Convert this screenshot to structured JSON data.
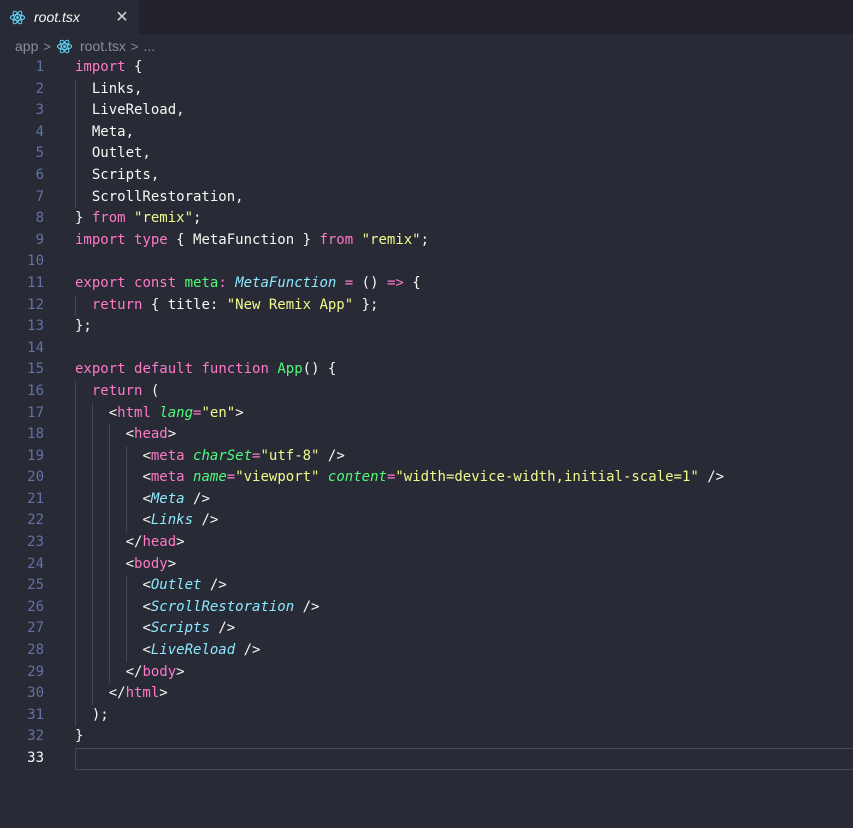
{
  "tab": {
    "title": "root.tsx",
    "icon": "react-icon",
    "close_glyph": "✕"
  },
  "breadcrumb": {
    "folder": "app",
    "file": "root.tsx",
    "more": "...",
    "separator": ">"
  },
  "colors": {
    "background": "#282a36",
    "keyword": "#ff79c6",
    "function": "#50fa7b",
    "string": "#f1fa8c",
    "type": "#8be9fd",
    "line_number": "#6272a4",
    "react_icon": "#61dafb"
  },
  "editor": {
    "active_line": 33,
    "lines": [
      {
        "n": "1",
        "indent": 0,
        "tokens": [
          [
            "k",
            "import"
          ],
          [
            "p",
            " {"
          ]
        ]
      },
      {
        "n": "2",
        "indent": 1,
        "tokens": [
          [
            "p",
            "Links,"
          ]
        ]
      },
      {
        "n": "3",
        "indent": 1,
        "tokens": [
          [
            "p",
            "LiveReload,"
          ]
        ]
      },
      {
        "n": "4",
        "indent": 1,
        "tokens": [
          [
            "p",
            "Meta,"
          ]
        ]
      },
      {
        "n": "5",
        "indent": 1,
        "tokens": [
          [
            "p",
            "Outlet,"
          ]
        ]
      },
      {
        "n": "6",
        "indent": 1,
        "tokens": [
          [
            "p",
            "Scripts,"
          ]
        ]
      },
      {
        "n": "7",
        "indent": 1,
        "tokens": [
          [
            "p",
            "ScrollRestoration,"
          ]
        ]
      },
      {
        "n": "8",
        "indent": 0,
        "tokens": [
          [
            "p",
            "} "
          ],
          [
            "k",
            "from"
          ],
          [
            "p",
            " "
          ],
          [
            "s",
            "\"remix\""
          ],
          [
            "p",
            ";"
          ]
        ]
      },
      {
        "n": "9",
        "indent": 0,
        "tokens": [
          [
            "k",
            "import"
          ],
          [
            "p",
            " "
          ],
          [
            "k",
            "type"
          ],
          [
            "p",
            " { MetaFunction } "
          ],
          [
            "k",
            "from"
          ],
          [
            "p",
            " "
          ],
          [
            "s",
            "\"remix\""
          ],
          [
            "p",
            ";"
          ]
        ]
      },
      {
        "n": "10",
        "indent": 0,
        "tokens": []
      },
      {
        "n": "11",
        "indent": 0,
        "tokens": [
          [
            "k",
            "export"
          ],
          [
            "p",
            " "
          ],
          [
            "k",
            "const"
          ],
          [
            "p",
            " "
          ],
          [
            "f",
            "meta"
          ],
          [
            "k",
            ":"
          ],
          [
            "p",
            " "
          ],
          [
            "t",
            "MetaFunction"
          ],
          [
            "p",
            " "
          ],
          [
            "k",
            "="
          ],
          [
            "p",
            " () "
          ],
          [
            "k",
            "=>"
          ],
          [
            "p",
            " {"
          ]
        ]
      },
      {
        "n": "12",
        "indent": 1,
        "tokens": [
          [
            "k",
            "return"
          ],
          [
            "p",
            " { title: "
          ],
          [
            "s",
            "\"New Remix App\""
          ],
          [
            "p",
            " };"
          ]
        ]
      },
      {
        "n": "13",
        "indent": 0,
        "tokens": [
          [
            "p",
            "};"
          ]
        ]
      },
      {
        "n": "14",
        "indent": 0,
        "tokens": []
      },
      {
        "n": "15",
        "indent": 0,
        "tokens": [
          [
            "k",
            "export"
          ],
          [
            "p",
            " "
          ],
          [
            "k",
            "default"
          ],
          [
            "p",
            " "
          ],
          [
            "k",
            "function"
          ],
          [
            "p",
            " "
          ],
          [
            "f",
            "App"
          ],
          [
            "p",
            "() {"
          ]
        ]
      },
      {
        "n": "16",
        "indent": 1,
        "tokens": [
          [
            "k",
            "return"
          ],
          [
            "p",
            " ("
          ]
        ]
      },
      {
        "n": "17",
        "indent": 2,
        "tokens": [
          [
            "p",
            "<"
          ],
          [
            "tg",
            "html"
          ],
          [
            "p",
            " "
          ],
          [
            "a",
            "lang"
          ],
          [
            "k",
            "="
          ],
          [
            "s",
            "\"en\""
          ],
          [
            "p",
            ">"
          ]
        ]
      },
      {
        "n": "18",
        "indent": 3,
        "tokens": [
          [
            "p",
            "<"
          ],
          [
            "tg",
            "head"
          ],
          [
            "p",
            ">"
          ]
        ]
      },
      {
        "n": "19",
        "indent": 4,
        "tokens": [
          [
            "p",
            "<"
          ],
          [
            "tg",
            "meta"
          ],
          [
            "p",
            " "
          ],
          [
            "a",
            "charSet"
          ],
          [
            "k",
            "="
          ],
          [
            "s",
            "\"utf-8\""
          ],
          [
            "p",
            " />"
          ]
        ]
      },
      {
        "n": "20",
        "indent": 4,
        "tokens": [
          [
            "p",
            "<"
          ],
          [
            "tg",
            "meta"
          ],
          [
            "p",
            " "
          ],
          [
            "a",
            "name"
          ],
          [
            "k",
            "="
          ],
          [
            "s",
            "\"viewport\""
          ],
          [
            "p",
            " "
          ],
          [
            "a",
            "content"
          ],
          [
            "k",
            "="
          ],
          [
            "s",
            "\"width=device-width,initial-scale=1\""
          ],
          [
            "p",
            " />"
          ]
        ]
      },
      {
        "n": "21",
        "indent": 4,
        "tokens": [
          [
            "p",
            "<"
          ],
          [
            "t",
            "Meta"
          ],
          [
            "p",
            " />"
          ]
        ]
      },
      {
        "n": "22",
        "indent": 4,
        "tokens": [
          [
            "p",
            "<"
          ],
          [
            "t",
            "Links"
          ],
          [
            "p",
            " />"
          ]
        ]
      },
      {
        "n": "23",
        "indent": 3,
        "tokens": [
          [
            "p",
            "</"
          ],
          [
            "tg",
            "head"
          ],
          [
            "p",
            ">"
          ]
        ]
      },
      {
        "n": "24",
        "indent": 3,
        "tokens": [
          [
            "p",
            "<"
          ],
          [
            "tg",
            "body"
          ],
          [
            "p",
            ">"
          ]
        ]
      },
      {
        "n": "25",
        "indent": 4,
        "tokens": [
          [
            "p",
            "<"
          ],
          [
            "t",
            "Outlet"
          ],
          [
            "p",
            " />"
          ]
        ]
      },
      {
        "n": "26",
        "indent": 4,
        "tokens": [
          [
            "p",
            "<"
          ],
          [
            "t",
            "ScrollRestoration"
          ],
          [
            "p",
            " />"
          ]
        ]
      },
      {
        "n": "27",
        "indent": 4,
        "tokens": [
          [
            "p",
            "<"
          ],
          [
            "t",
            "Scripts"
          ],
          [
            "p",
            " />"
          ]
        ]
      },
      {
        "n": "28",
        "indent": 4,
        "tokens": [
          [
            "p",
            "<"
          ],
          [
            "t",
            "LiveReload"
          ],
          [
            "p",
            " />"
          ]
        ]
      },
      {
        "n": "29",
        "indent": 3,
        "tokens": [
          [
            "p",
            "</"
          ],
          [
            "tg",
            "body"
          ],
          [
            "p",
            ">"
          ]
        ]
      },
      {
        "n": "30",
        "indent": 2,
        "tokens": [
          [
            "p",
            "</"
          ],
          [
            "tg",
            "html"
          ],
          [
            "p",
            ">"
          ]
        ]
      },
      {
        "n": "31",
        "indent": 1,
        "tokens": [
          [
            "p",
            ");"
          ]
        ]
      },
      {
        "n": "32",
        "indent": 0,
        "tokens": [
          [
            "p",
            "}"
          ]
        ]
      },
      {
        "n": "33",
        "indent": 0,
        "tokens": []
      }
    ]
  }
}
